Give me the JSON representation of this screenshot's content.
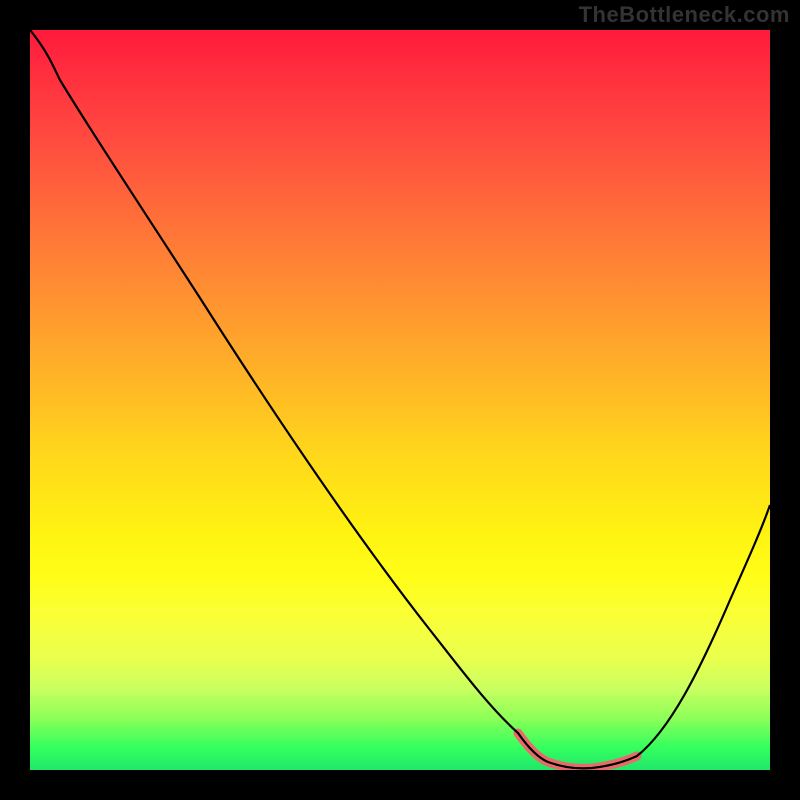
{
  "watermark": "TheBottleneck.com",
  "colors": {
    "background": "#000000",
    "curve": "#000000",
    "highlight": "#e96a6a"
  },
  "chart_data": {
    "type": "line",
    "title": "",
    "xlabel": "",
    "ylabel": "",
    "xlim": [
      0,
      100
    ],
    "ylim": [
      0,
      100
    ],
    "grid": false,
    "legend": false,
    "background": "rainbow-vertical-gradient (red top to green bottom)",
    "series": [
      {
        "name": "bottleneck-curve",
        "x": [
          0,
          4,
          10,
          20,
          30,
          40,
          50,
          58,
          62,
          66,
          70,
          74,
          78,
          82,
          88,
          94,
          100
        ],
        "y": [
          100,
          96,
          89,
          75,
          61,
          47,
          33,
          19,
          11,
          5,
          1,
          0,
          0,
          1,
          8,
          20,
          36
        ]
      },
      {
        "name": "optimal-range-highlight",
        "x": [
          66,
          70,
          74,
          78,
          82
        ],
        "y": [
          5,
          1,
          0,
          0,
          1
        ],
        "style": "thick-pink"
      }
    ],
    "notes": "Y values estimated from vertical position of black curve over rainbow gradient; 0 = bottom (green/optimal), 100 = top (red/severe)."
  }
}
